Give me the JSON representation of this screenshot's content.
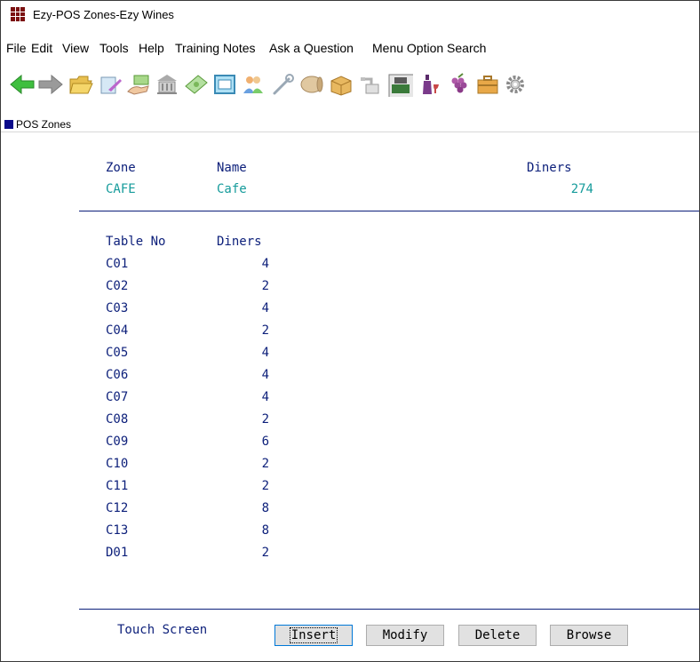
{
  "window": {
    "title": "Ezy-POS Zones-Ezy Wines"
  },
  "menu": [
    "File",
    "Edit",
    "View",
    "Tools",
    "Help",
    "Training Notes",
    "Ask a Question",
    "Menu Option Search"
  ],
  "toolbar": {
    "icons": [
      "back-arrow-icon",
      "forward-arrow-icon",
      "folder-icon",
      "paper-icon",
      "money-hand-icon",
      "bank-icon",
      "banknote-icon",
      "screen-icon",
      "people-icon",
      "wrench-icon",
      "barrel-icon",
      "box-icon",
      "tap-icon",
      "cash-register-icon",
      "wine-bottle-icon",
      "grapes-icon",
      "briefcase-icon",
      "gear-icon"
    ]
  },
  "subtitle": "POS Zones",
  "zone_header": {
    "zone": "Zone",
    "name": "Name",
    "diners": "Diners"
  },
  "zone": {
    "code": "CAFE",
    "name": "Cafe",
    "diners": "274"
  },
  "tables_header": {
    "table_no": "Table No",
    "diners": "Diners"
  },
  "tables": [
    {
      "no": "C01",
      "diners": "4"
    },
    {
      "no": "C02",
      "diners": "2"
    },
    {
      "no": "C03",
      "diners": "4"
    },
    {
      "no": "C04",
      "diners": "2"
    },
    {
      "no": "C05",
      "diners": "4"
    },
    {
      "no": "C06",
      "diners": "4"
    },
    {
      "no": "C07",
      "diners": "4"
    },
    {
      "no": "C08",
      "diners": "2"
    },
    {
      "no": "C09",
      "diners": "6"
    },
    {
      "no": "C10",
      "diners": "2"
    },
    {
      "no": "C11",
      "diners": "2"
    },
    {
      "no": "C12",
      "diners": "8"
    },
    {
      "no": "C13",
      "diners": "8"
    },
    {
      "no": "D01",
      "diners": "2"
    }
  ],
  "footer": {
    "touch_screen": "Touch Screen",
    "insert": "Insert",
    "modify": "Modify",
    "delete": "Delete",
    "browse": "Browse"
  }
}
